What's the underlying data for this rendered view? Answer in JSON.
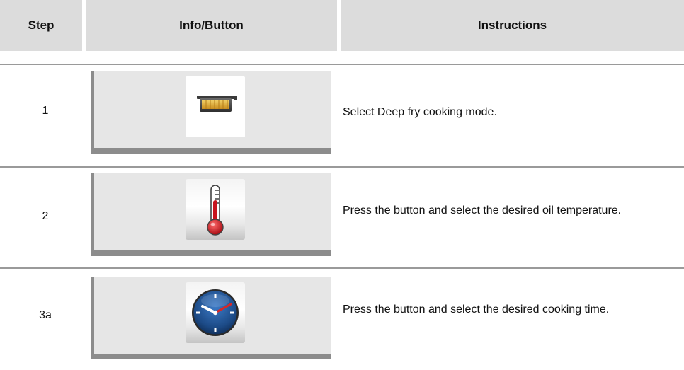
{
  "header": {
    "step": "Step",
    "info_button": "Info/Button",
    "instructions": "Instructions"
  },
  "rows": [
    {
      "step": "1",
      "icon": "deep-fry-pot-icon",
      "instruction": "Select Deep fry cooking mode."
    },
    {
      "step": "2",
      "icon": "thermometer-icon",
      "instruction": "Press the button and select the desired oil temperature."
    },
    {
      "step": "3a",
      "icon": "clock-icon",
      "instruction": "Press the button and select the desired cooking time."
    }
  ],
  "colors": {
    "header_bg": "#dcdcdc",
    "panel_bg": "#e6e6e6",
    "panel_border": "#8c8c8c",
    "separator": "#9a9a9a",
    "thermometer_red": "#c8141e",
    "clock_blue": "#1c4a86"
  }
}
